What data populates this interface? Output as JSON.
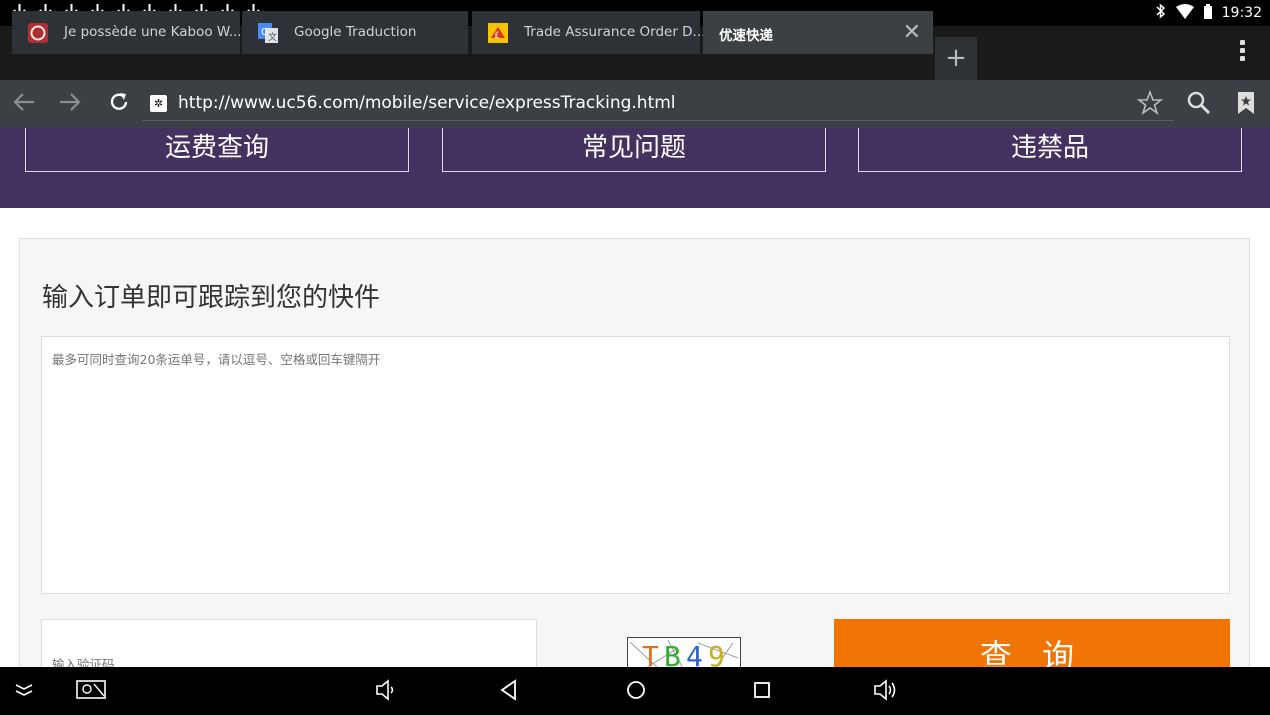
{
  "status_bar": {
    "download_icon_count": 10,
    "time": "19:32"
  },
  "tabs": [
    {
      "label": "Je possède une Kaboo W...",
      "favicon": "red-circle-icon"
    },
    {
      "label": "Google Traduction",
      "favicon": "google-translate-icon"
    },
    {
      "label": "Trade Assurance Order D...",
      "favicon": "trade-assurance-icon"
    },
    {
      "label": "优速快递",
      "favicon": "none",
      "active": true
    }
  ],
  "address_bar": {
    "url": "http://www.uc56.com/mobile/service/expressTracking.html"
  },
  "page": {
    "service_buttons": [
      "运费查询",
      "常见问题",
      "违禁品"
    ],
    "card_title": "输入订单即可跟踪到您的快件",
    "tracking_placeholder": "最多可同时查询20条运单号，请以逗号、空格或回车键隔开",
    "captcha_placeholder": "输入验证码",
    "captcha_chars": [
      {
        "ch": "T",
        "color": "#e07020"
      },
      {
        "ch": "B",
        "color": "#30b030"
      },
      {
        "ch": "4",
        "color": "#2a66c8"
      },
      {
        "ch": "9",
        "color": "#c8b020"
      }
    ],
    "query_button": "查 询"
  },
  "colors": {
    "purple_header": "#43315f",
    "query_orange": "#f07406"
  }
}
